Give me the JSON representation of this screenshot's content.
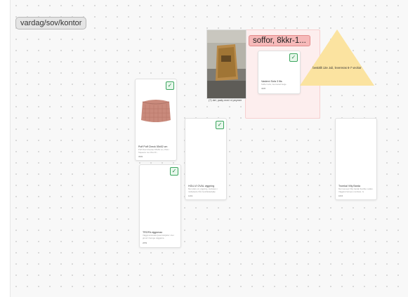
{
  "section": {
    "label": "vardag/sov/kontor"
  },
  "sofa_group": {
    "label": "soffor, 8kkr-1..."
  },
  "photo": {
    "caption": "(?) del, pady med ni peymer"
  },
  "triangle_note": {
    "text": "beställt 13e Juli, levereras 6-7 veckor"
  },
  "cards": {
    "sofa": {
      "title": "Vastervi Sofa 3 fits",
      "desc": "Soffa 3-sits, Gunnared beige",
      "price": "4995",
      "checked": true
    },
    "pouf": {
      "title": "Puff Puff Check 55x52 cm",
      "desc": "Puff Pouf Checker 55x52 cm, Pink / Squeeze me Cha Ch...",
      "price": "3999",
      "checked": true
    },
    "hollvi": {
      "title": "HOLLVI OVAL viggning",
      "desc": "Mer plats om viggning, storleken i möbelserie från fa.stiftelsehjälp",
      "price": "1419",
      "checked": true
    },
    "trofa": {
      "title": "TROFA viggnmax",
      "desc": "Väggmonterade ljusa boklyktor i det grund i beruge väggarna",
      "price": "2659",
      "checked": true
    },
    "tromkal": {
      "title": "Tromkal Villy Barda",
      "desc": "Mer koncept Villy bardar flexible mellan. Väggtrar lamepo nomitare. G",
      "price": "1615",
      "checked": false
    }
  },
  "icons": {
    "check": "checkmark-icon",
    "price_tag": "tag-icon"
  },
  "colors": {
    "section_bg": "#e4e4e4",
    "sofa_frame": "#fdeeee",
    "sofa_label": "#f6b9b9",
    "triangle": "#fbe3a0",
    "check_green": "#3aa55d"
  }
}
